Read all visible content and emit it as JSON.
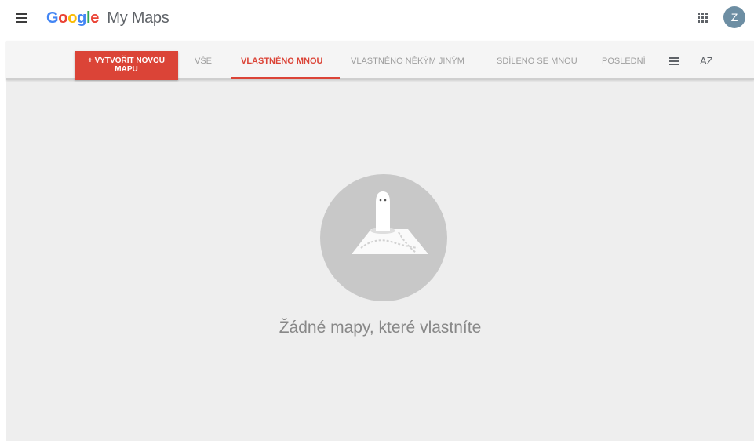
{
  "header": {
    "logo_letters": [
      {
        "char": "G",
        "color": "#4285F4"
      },
      {
        "char": "o",
        "color": "#EA4335"
      },
      {
        "char": "o",
        "color": "#FBBC05"
      },
      {
        "char": "g",
        "color": "#4285F4"
      },
      {
        "char": "l",
        "color": "#34A853"
      },
      {
        "char": "e",
        "color": "#EA4335"
      }
    ],
    "product_name": "My Maps",
    "menu_icon": "hamburger-menu-icon",
    "apps_icon": "apps-grid-icon",
    "avatar_letter": "Z"
  },
  "toolbar": {
    "create_button_line1": "+ VYTVOŘIT NOVOU",
    "create_button_line2": "MAPU",
    "tabs": [
      {
        "label": "VŠE",
        "active": false
      },
      {
        "label": "VLASTNĚNO MNOU",
        "active": true
      },
      {
        "label": "VLASTNĚNO NĚKÝM JINÝM",
        "active": false
      },
      {
        "label": "SDÍLENO SE MNOU",
        "active": false
      },
      {
        "label": "POSLEDNÍ",
        "active": false
      }
    ],
    "list_view_icon": "list-view-icon",
    "sort_icon_label": "AZ"
  },
  "empty_state": {
    "message": "Žádné mapy, které vlastníte",
    "illustration_icon": "ghost-on-map-icon"
  },
  "colors": {
    "accent": "#db4437",
    "avatar": "#6d8ea3",
    "background": "#eeeeee"
  }
}
